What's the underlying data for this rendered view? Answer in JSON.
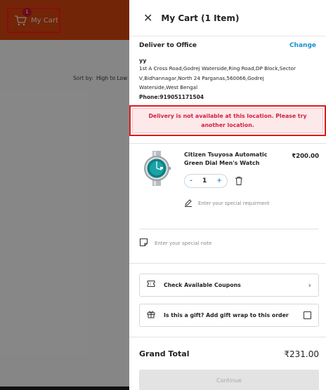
{
  "background": {
    "cart_badge_count": "1",
    "cart_label": "My Cart",
    "sort_label": "Sort by:",
    "sort_value": "High to Low"
  },
  "drawer": {
    "title": "My Cart (1 Item)"
  },
  "address": {
    "heading": "Deliver to Office",
    "change_label": "Change",
    "name": "yy",
    "lines": [
      "1st A Cross Road,Godrej Waterside,Ring Road,DP Block,Sector",
      "V,Bidhannagar,North 24 Parganas,560066,Godrej",
      "Waterside,West Bengal"
    ],
    "phone": "Phone:919051171504"
  },
  "warning": {
    "message": "Delivery is not available at this location. Please try another location."
  },
  "cart_item": {
    "name": "Citizen Tsuyosa Automatic Green Dial Men's Watch",
    "price": "₹200.00",
    "quantity": "1",
    "minus_label": "-",
    "plus_label": "+",
    "requirement_placeholder": "Enter your special requirment"
  },
  "note": {
    "placeholder": "Enter your special note"
  },
  "options": {
    "coupons_label": "Check Available Coupons",
    "gift_label": "Is this a gift? Add gift wrap to this order"
  },
  "totals": {
    "grand_label": "Grand Total",
    "grand_value": "₹231.00"
  },
  "continue_label": "Continue",
  "colors": {
    "brand_orange": "#d2440d",
    "link_blue": "#1a8fd1",
    "warning_red": "#d31f3c",
    "highlight_red": "#ff1a1a"
  }
}
